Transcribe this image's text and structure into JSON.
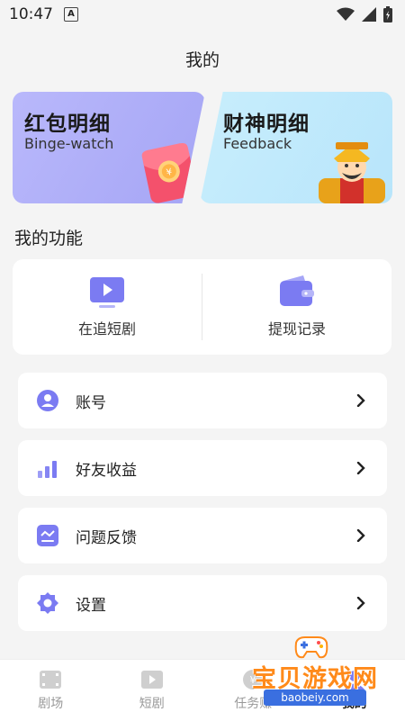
{
  "status_bar": {
    "time": "10:47",
    "notification_letter": "A"
  },
  "header": {
    "title": "我的"
  },
  "banners": [
    {
      "title": "红包明细",
      "subtitle": "Binge-watch",
      "art_icon": "red-envelope-icon"
    },
    {
      "title": "财神明细",
      "subtitle": "Feedback",
      "art_icon": "fortune-god-icon"
    }
  ],
  "functions": {
    "title": "我的功能",
    "items": [
      {
        "label": "在追短剧",
        "icon": "tv-play-icon"
      },
      {
        "label": "提现记录",
        "icon": "wallet-icon"
      }
    ]
  },
  "menu": [
    {
      "label": "账号",
      "icon": "user-icon"
    },
    {
      "label": "好友收益",
      "icon": "bar-chart-icon"
    },
    {
      "label": "问题反馈",
      "icon": "feedback-icon"
    },
    {
      "label": "设置",
      "icon": "gear-icon"
    }
  ],
  "tabbar": [
    {
      "label": "剧场",
      "icon": "film-icon",
      "active": false
    },
    {
      "label": "短剧",
      "icon": "video-icon",
      "active": false
    },
    {
      "label": "任务赚",
      "icon": "coin-icon",
      "active": false
    },
    {
      "label": "我的",
      "icon": "profile-icon",
      "active": true
    }
  ],
  "watermark": {
    "text": "宝贝游戏网",
    "url": "baobeiy.com"
  },
  "colors": {
    "accent": "#7b7bf2",
    "banner_left": "#b0affa",
    "banner_right": "#c2ebfc"
  }
}
